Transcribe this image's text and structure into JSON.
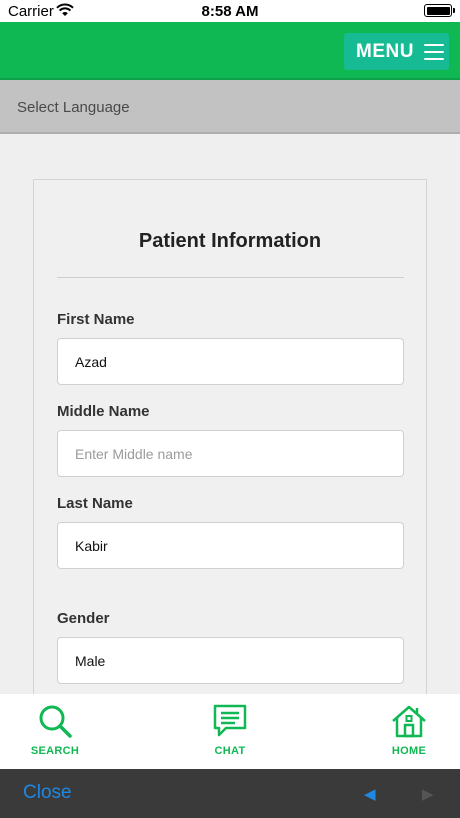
{
  "status_bar": {
    "carrier": "Carrier",
    "time": "8:58 AM"
  },
  "header": {
    "menu_label": "MENU"
  },
  "language_bar": {
    "label": "Select Language"
  },
  "form": {
    "title": "Patient Information",
    "fields": [
      {
        "label": "First Name",
        "value": "Azad",
        "placeholder": ""
      },
      {
        "label": "Middle Name",
        "value": "",
        "placeholder": "Enter Middle name"
      },
      {
        "label": "Last Name",
        "value": "Kabir",
        "placeholder": ""
      },
      {
        "label": "Gender",
        "value": "Male",
        "placeholder": ""
      }
    ]
  },
  "tab_bar": {
    "tabs": [
      {
        "label": "SEARCH",
        "icon": "search-icon"
      },
      {
        "label": "CHAT",
        "icon": "chat-icon"
      },
      {
        "label": "HOME",
        "icon": "home-icon"
      }
    ]
  },
  "bottom_toolbar": {
    "close_label": "Close",
    "back_glyph": "◀",
    "forward_glyph": "▶"
  },
  "colors": {
    "header_green": "#10b853",
    "menu_teal": "#16bb93",
    "tab_green": "#10b853",
    "link_blue": "#1e88e5"
  }
}
